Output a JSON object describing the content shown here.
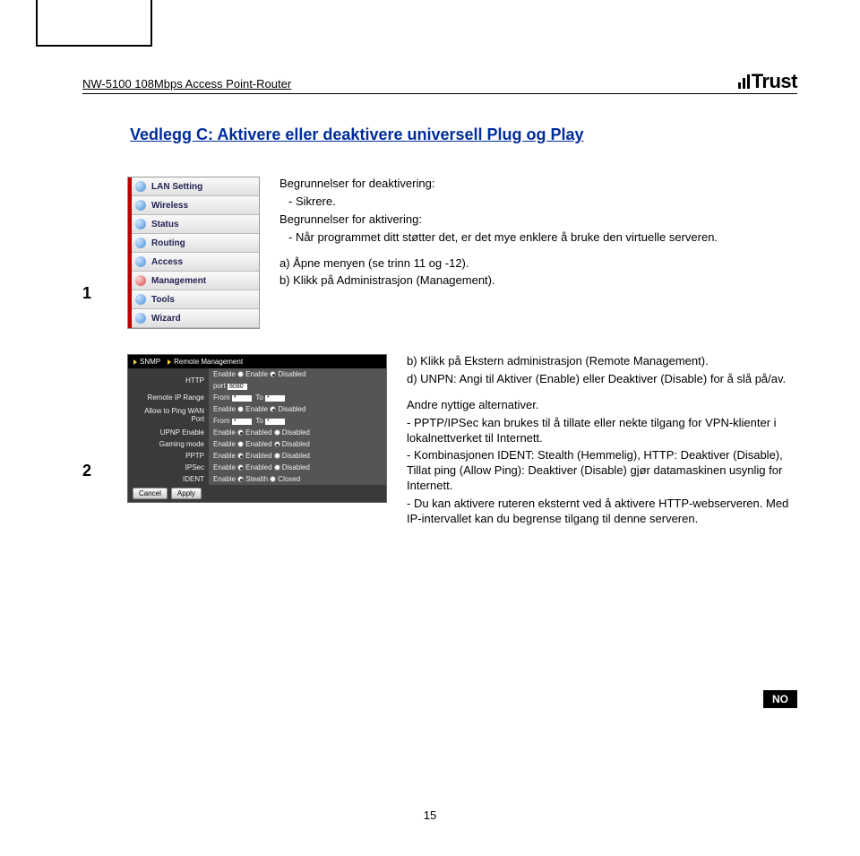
{
  "header": {
    "product": "NW-5100 108Mbps Access Point-Router",
    "brand": "Trust"
  },
  "title": "Vedlegg C: Aktivere eller deaktivere universell Plug og Play",
  "section1": {
    "number": "1",
    "menu": [
      "LAN Setting",
      "Wireless",
      "Status",
      "Routing",
      "Access",
      "Management",
      "Tools",
      "Wizard"
    ],
    "deact_heading": "Begrunnelser for deaktivering:",
    "deact_item": "-    Sikrere.",
    "act_heading": "Begrunnelser for aktivering:",
    "act_item": "-    Når programmet ditt støtter det, er det mye enklere å bruke den virtuelle serveren.",
    "step_a": "a) Åpne menyen (se trinn 11 og -12).",
    "step_b": "b) Klikk på  Administrasjon (Management)."
  },
  "section2": {
    "number": "2",
    "panel": {
      "tabs": {
        "snmp": "SNMP",
        "remote": "Remote Management"
      },
      "rows": {
        "http_lbl": "HTTP",
        "http_val": {
          "enable": "Enable",
          "enabled": "Enable",
          "disabled": "Disabled",
          "port": "port",
          "portval": "8080"
        },
        "pingwan_lbl": "Allow to Ping WAN Port",
        "pingwan_val": {
          "enable": "Enable",
          "enabled": "Enable",
          "disabled": "Disabled"
        },
        "iprange_lbl": "Remote IP Range",
        "iprange_val": {
          "from": "From",
          "star1": "*",
          "to": "To",
          "star2": "*"
        },
        "upnp_lbl": "UPNP Enable",
        "gaming_lbl": "Gaming mode",
        "pptp_lbl": "PPTP",
        "ipsec_lbl": "IPSec",
        "ident_lbl": "IDENT",
        "enable_opt": {
          "enable": "Enable",
          "enabled": "Enabled",
          "disabled": "Disabled",
          "stealth": "Stealth",
          "closed": "Closed"
        }
      },
      "buttons": {
        "cancel": "Cancel",
        "apply": "Apply"
      }
    },
    "para_b": "b) Klikk på  Ekstern administrasjon (Remote Management).",
    "para_d": "d) UNPN: Angi til Aktiver (Enable) eller  Deaktiver (Disable) for å slå på/av.",
    "other_heading": "Andre nyttige alternativer.",
    "bullet1": "- PPTP/IPSec kan brukes til å tillate eller nekte tilgang for VPN-klienter i lokalnettverket til Internett.",
    "bullet2": "- Kombinasjonen IDENT: Stealth (Hemmelig), HTTP: Deaktiver (Disable),  Tillat ping (Allow Ping): Deaktiver (Disable) gjør datamaskinen usynlig for Internett.",
    "bullet3": "- Du kan aktivere ruteren eksternt ved å aktivere HTTP-webserveren. Med IP-intervallet kan du begrense tilgang til denne serveren."
  },
  "footer": {
    "page": "15",
    "lang": "NO"
  }
}
